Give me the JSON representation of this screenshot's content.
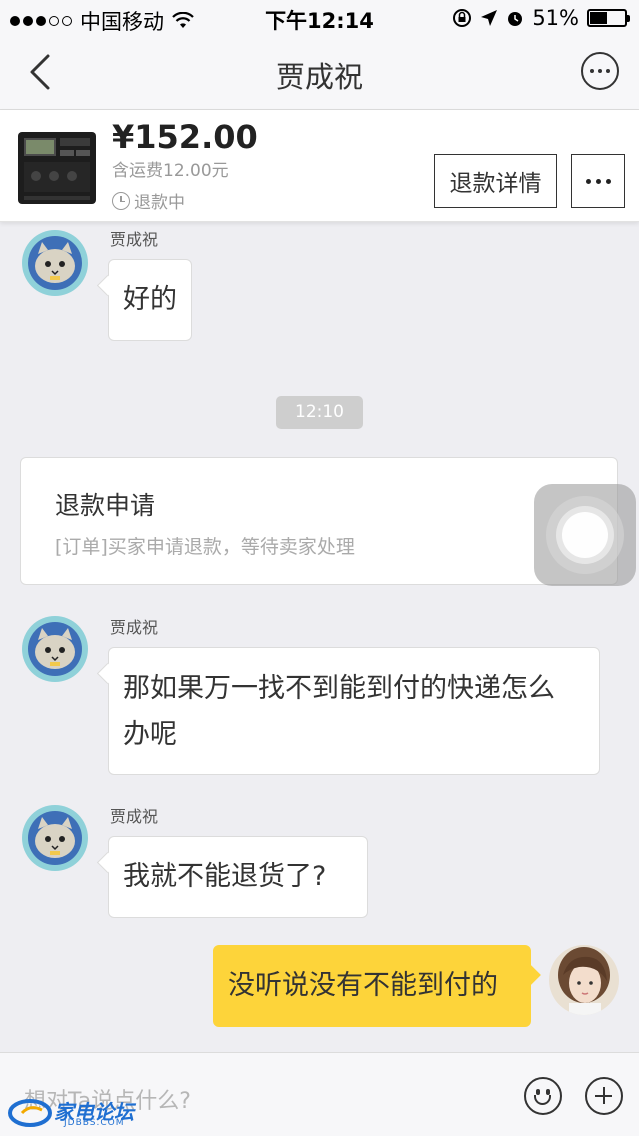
{
  "status_bar": {
    "carrier": "中国移动",
    "time": "下午12:14",
    "battery_pct": "51%",
    "battery_level": 0.51
  },
  "nav": {
    "title": "贾成祝"
  },
  "product": {
    "price": "¥152.00",
    "shipping": "含运费12.00元",
    "status": "退款中",
    "refund_detail_label": "退款详情"
  },
  "messages": [
    {
      "sender": "贾成祝",
      "text": "好的"
    },
    {
      "timestamp": "12:10"
    },
    {
      "card_title": "退款申请",
      "card_subtitle": "[订单]买家申请退款，等待卖家处理"
    },
    {
      "sender": "贾成祝",
      "text_line1": "那如果万一找不到能到付的快递怎么",
      "text_line2": "办呢"
    },
    {
      "sender": "贾成祝",
      "text": "我就不能退货了?"
    },
    {
      "text": "没听说没有不能到付的"
    }
  ],
  "input": {
    "placeholder": "想对Ta说点什么?"
  },
  "watermark": {
    "text": "家电论坛",
    "sub": "JDBBS.COM"
  },
  "colors": {
    "accent_yellow": "#fdd43a",
    "background": "#eeeef2"
  },
  "icons": [
    "back-icon",
    "more-icon",
    "clock-icon",
    "emoji-icon",
    "plus-icon",
    "wifi-icon",
    "signal-icon"
  ]
}
